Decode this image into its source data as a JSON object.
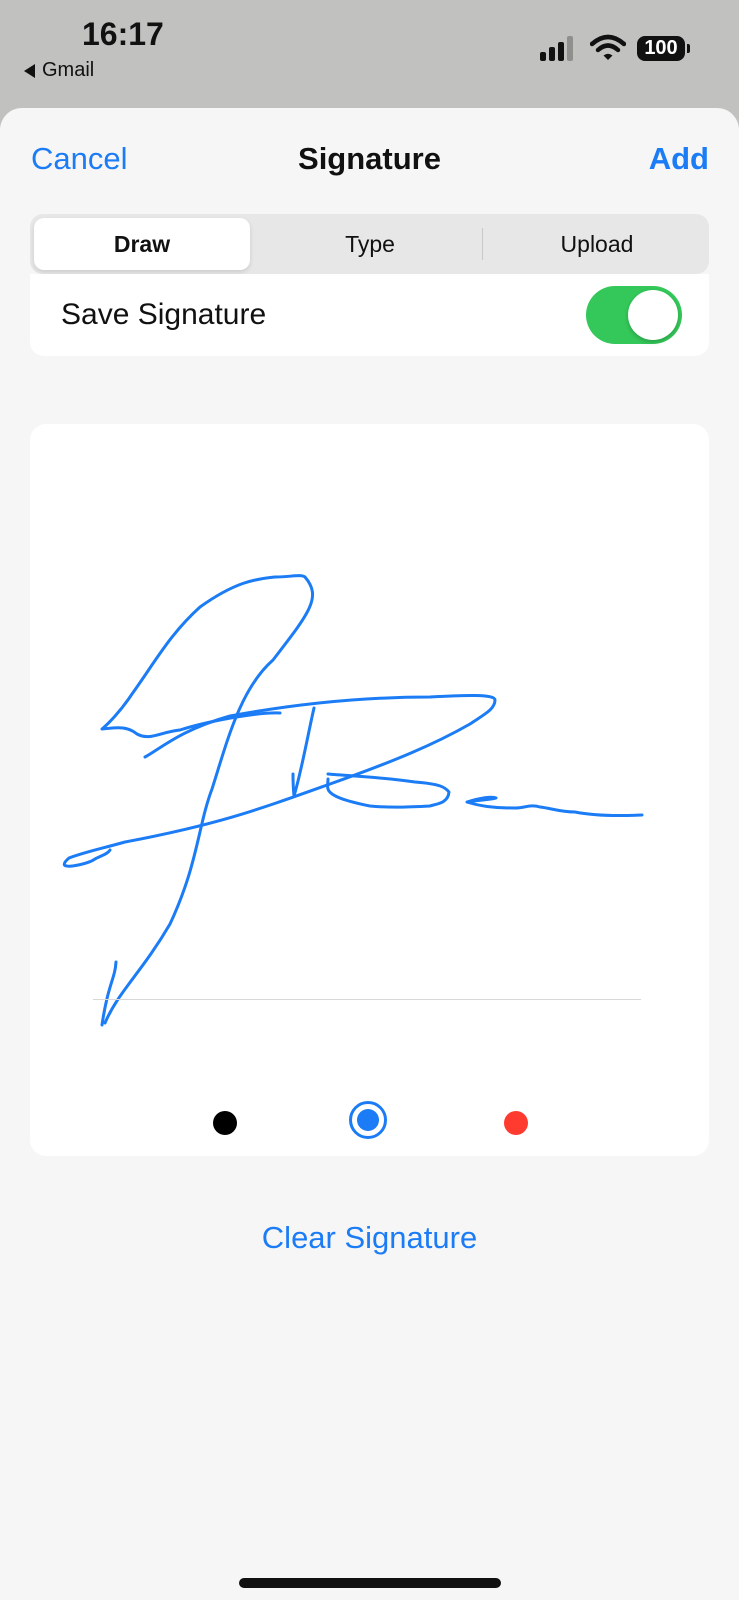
{
  "status_bar": {
    "time": "16:17",
    "back_app": "Gmail",
    "battery": "100"
  },
  "nav": {
    "cancel_label": "Cancel",
    "title": "Signature",
    "add_label": "Add"
  },
  "segments": [
    {
      "label": "Draw",
      "active": true
    },
    {
      "label": "Type",
      "active": false
    },
    {
      "label": "Upload",
      "active": false
    }
  ],
  "save_signature": {
    "label": "Save Signature",
    "enabled": true
  },
  "pen_colors": {
    "options": [
      "black",
      "blue",
      "red"
    ],
    "selected": "blue",
    "black": "#000000",
    "blue": "#1b7cf5",
    "red": "#ff3b30"
  },
  "clear_label": "Clear Signature",
  "colors": {
    "accent": "#1b7cf5",
    "toggle_on": "#34c759",
    "signature_stroke": "#1b7cf5"
  },
  "icons": {
    "back": "back-triangle-icon",
    "signal": "cellular-signal-icon",
    "wifi": "wifi-icon",
    "battery": "battery-icon"
  }
}
